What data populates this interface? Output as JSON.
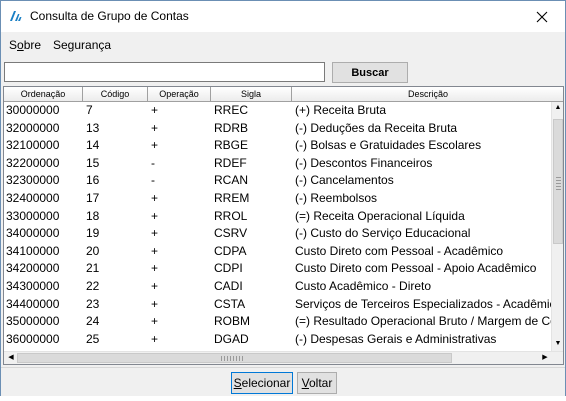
{
  "window": {
    "title": "Consulta de Grupo de Contas"
  },
  "menu": [
    {
      "label": "Sobre",
      "accel": "o"
    },
    {
      "label": "Segurança",
      "accel": ""
    }
  ],
  "search": {
    "value": "",
    "button_label": "Buscar"
  },
  "table": {
    "columns": [
      "Ordenação",
      "Código",
      "Operação",
      "Sigla",
      "Descrição"
    ],
    "rows": [
      [
        "30000000",
        "7",
        "+",
        "RREC",
        "(+) Receita Bruta"
      ],
      [
        "32000000",
        "13",
        "+",
        "RDRB",
        "(-) Deduções da Receita Bruta"
      ],
      [
        "32100000",
        "14",
        "+",
        "RBGE",
        "(-) Bolsas e Gratuidades Escolares"
      ],
      [
        "32200000",
        "15",
        "-",
        "RDEF",
        "(-) Descontos Financeiros"
      ],
      [
        "32300000",
        "16",
        "-",
        "RCAN",
        "(-) Cancelamentos"
      ],
      [
        "32400000",
        "17",
        "+",
        "RREM",
        "(-) Reembolsos"
      ],
      [
        "33000000",
        "18",
        "+",
        "RROL",
        "(=) Receita Operacional Líquida"
      ],
      [
        "34000000",
        "19",
        "+",
        "CSRV",
        "(-) Custo do Serviço Educacional"
      ],
      [
        "34100000",
        "20",
        "+",
        "CDPA",
        "Custo Direto com Pessoal - Acadêmico"
      ],
      [
        "34200000",
        "21",
        "+",
        "CDPI",
        "Custo Direto com Pessoal - Apoio Acadêmico"
      ],
      [
        "34300000",
        "22",
        "+",
        "CADI",
        "Custo Acadêmico - Direto"
      ],
      [
        "34400000",
        "23",
        "+",
        "CSTA",
        "Serviços de Terceiros Especializados - Acadêmico"
      ],
      [
        "35000000",
        "24",
        "+",
        "ROBM",
        "(=) Resultado Operacional Bruto / Margem de Contribuição"
      ],
      [
        "36000000",
        "25",
        "+",
        "DGAD",
        "(-) Despesas Gerais e Administrativas"
      ]
    ]
  },
  "footer": {
    "select_label": "Selecionar",
    "select_accel": "S",
    "back_label": "Voltar",
    "back_accel": "V"
  },
  "icons": {
    "app": "app-logo-icon",
    "close": "close-icon",
    "scroll_up": "scroll-up-icon",
    "scroll_down": "scroll-down-icon",
    "scroll_left": "scroll-left-icon",
    "scroll_right": "scroll-right-icon"
  },
  "colors": {
    "accent": "#0078d7",
    "window_bg": "#f0f0f0",
    "app_icon": "#1a7fc4"
  }
}
